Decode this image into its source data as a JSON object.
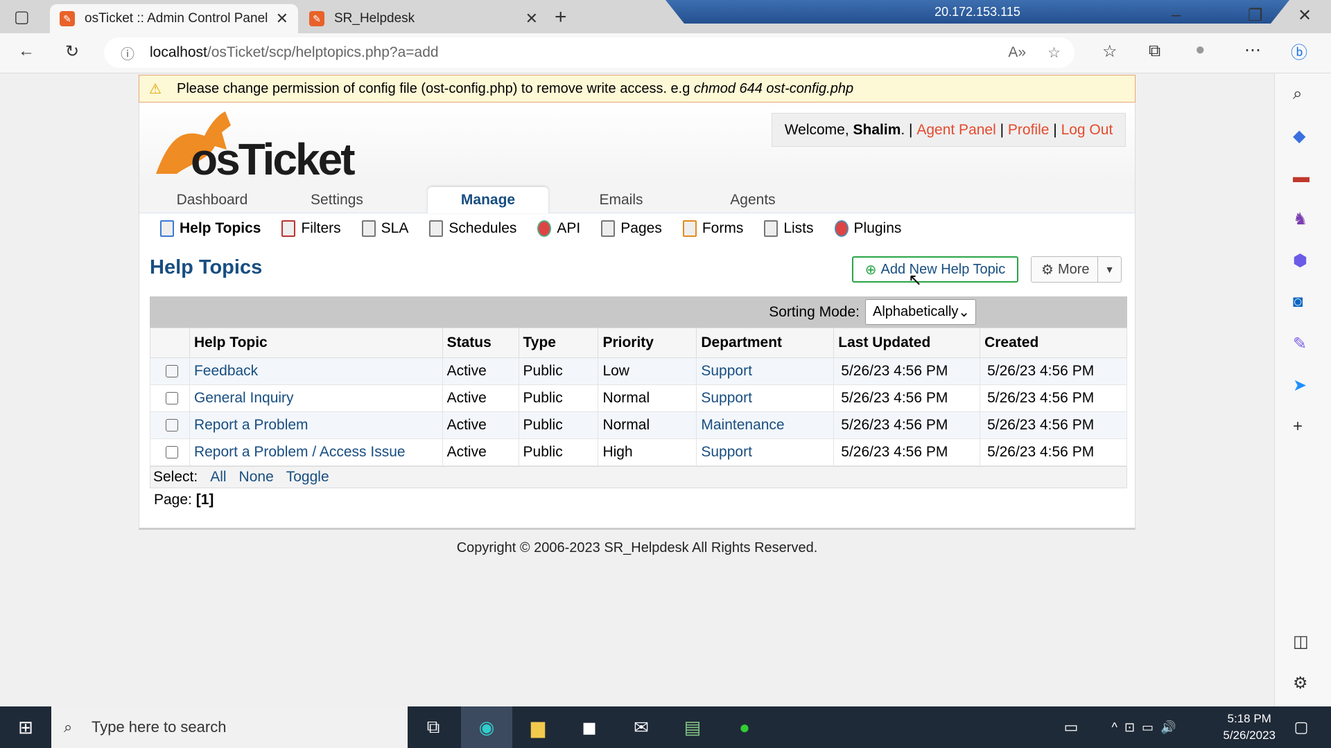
{
  "browser": {
    "tabs": [
      {
        "title": "osTicket :: Admin Control Panel",
        "active": true
      },
      {
        "title": "SR_Helpdesk",
        "active": false
      }
    ],
    "rdp_host": "20.172.153.115",
    "url_host": "localhost",
    "url_path": "/osTicket/scp/helptopics.php?a=add"
  },
  "warning": {
    "text": "Please change permission of config file (ost-config.php) to remove write access. e.g ",
    "code": "chmod 644 ost-config.php"
  },
  "header": {
    "logo_text": "osTicket",
    "welcome": "Welcome, ",
    "user": "Shalim",
    "links": [
      "Agent Panel",
      "Profile",
      "Log Out"
    ]
  },
  "nav": {
    "tabs": [
      "Dashboard",
      "Settings",
      "Manage",
      "Emails",
      "Agents"
    ],
    "active": "Manage"
  },
  "subnav": [
    "Help Topics",
    "Filters",
    "SLA",
    "Schedules",
    "API",
    "Pages",
    "Forms",
    "Lists",
    "Plugins"
  ],
  "main": {
    "title": "Help Topics",
    "add_button": "Add New Help Topic",
    "more_button": "More",
    "sorting_label": "Sorting Mode:",
    "sorting_value": "Alphabetically",
    "columns": [
      "Help Topic",
      "Status",
      "Type",
      "Priority",
      "Department",
      "Last Updated",
      "Created"
    ],
    "rows": [
      [
        "Feedback",
        "Active",
        "Public",
        "Low",
        "Support",
        "5/26/23 4:56 PM",
        "5/26/23 4:56 PM"
      ],
      [
        "General Inquiry",
        "Active",
        "Public",
        "Normal",
        "Support",
        "5/26/23 4:56 PM",
        "5/26/23 4:56 PM"
      ],
      [
        "Report a Problem",
        "Active",
        "Public",
        "Normal",
        "Maintenance",
        "5/26/23 4:56 PM",
        "5/26/23 4:56 PM"
      ],
      [
        "Report a Problem / Access Issue",
        "Active",
        "Public",
        "High",
        "Support",
        "5/26/23 4:56 PM",
        "5/26/23 4:56 PM"
      ]
    ],
    "select_label": "Select:",
    "select_links": [
      "All",
      "None",
      "Toggle"
    ],
    "page_label": "Page:",
    "page_value": "[1]"
  },
  "footer": {
    "copyright": "Copyright © 2006-2023 SR_Helpdesk All Rights Reserved."
  },
  "taskbar": {
    "search_placeholder": "Type here to search",
    "time": "5:18 PM",
    "date": "5/26/2023"
  },
  "colors": {
    "accent": "#184e81",
    "link": "#e44a2d",
    "add_border": "#2aa546",
    "warning_bg": "#fdf8d5"
  }
}
